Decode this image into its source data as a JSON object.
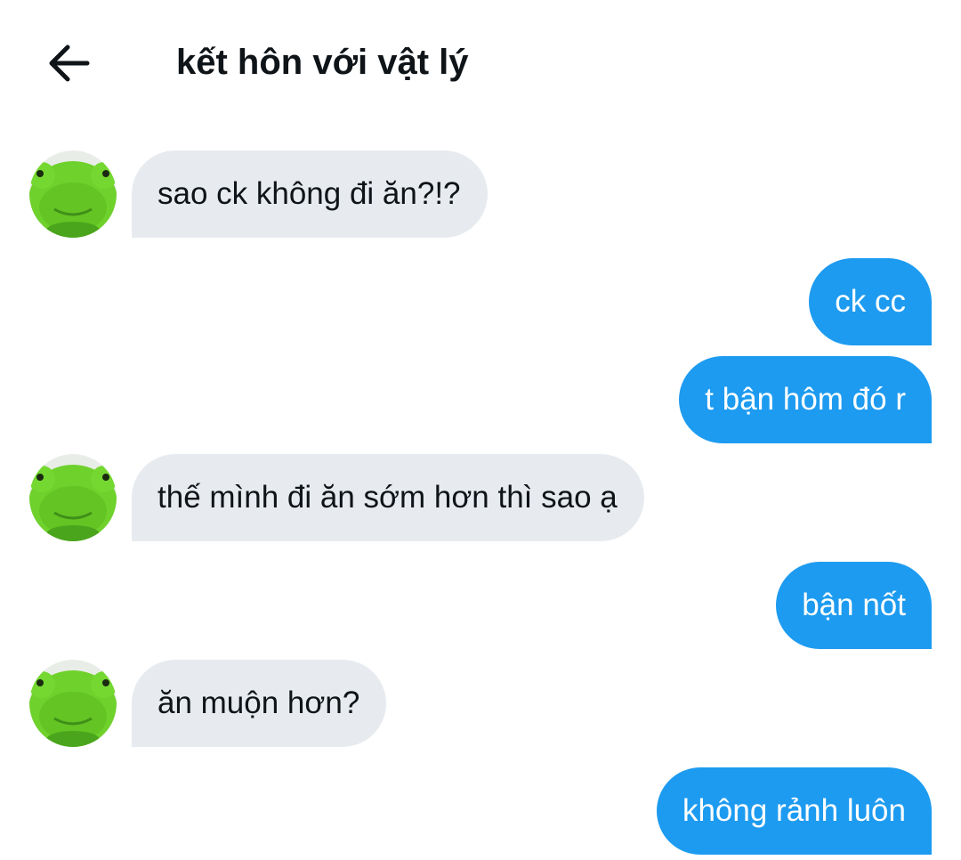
{
  "header": {
    "back_icon": "arrow-left-icon",
    "title": "kết hôn với vật lý"
  },
  "contact": {
    "avatar_icon": "green-frog-plush-avatar",
    "avatar_colors": {
      "fur": "#6fd12c",
      "shadow": "#3f8f18",
      "eyes": "#1b2a10"
    }
  },
  "colors": {
    "incoming_bubble": "#e7ebef",
    "outgoing_bubble": "#1d9bf0",
    "incoming_text": "#0f1419",
    "outgoing_text": "#ffffff"
  },
  "messages": [
    {
      "from": "them",
      "text": "sao ck không đi ăn?!?"
    },
    {
      "from": "me",
      "text": "ck cc"
    },
    {
      "from": "me",
      "text": "t bận hôm đó r"
    },
    {
      "from": "them",
      "text": "thế mình đi ăn sớm hơn thì sao ạ"
    },
    {
      "from": "me",
      "text": "bận nốt"
    },
    {
      "from": "them",
      "text": "ăn muộn hơn?"
    },
    {
      "from": "me",
      "text": "không rảnh luôn"
    }
  ]
}
